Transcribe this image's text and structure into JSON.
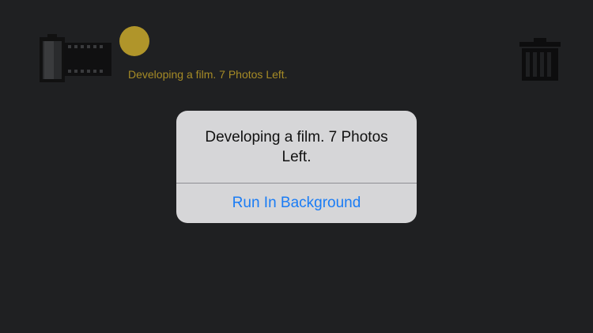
{
  "toolbar": {
    "film_icon": "film-roll-icon",
    "status_indicator_color": "#b0952a",
    "status_text": "Developing a film. 7 Photos Left.",
    "trash_icon": "trash-icon"
  },
  "alert": {
    "message": "Developing a film. 7 Photos Left.",
    "action_label": "Run In Background",
    "action_color": "#1a7cf5"
  },
  "colors": {
    "background": "#1f2022",
    "dialog_background": "#d6d6d8",
    "status_text": "#a68b26"
  }
}
